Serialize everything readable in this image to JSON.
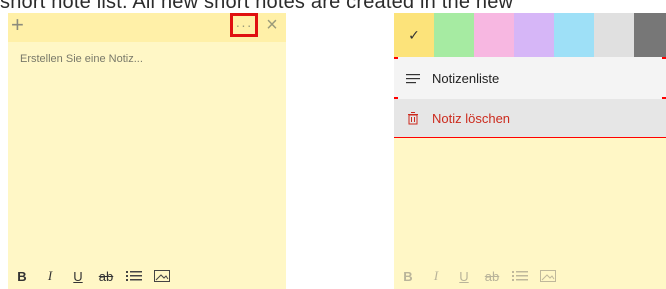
{
  "caption": "short note list. All new short notes are created in the new",
  "left_note": {
    "add_glyph": "+",
    "more_glyph": "···",
    "close_glyph": "×",
    "placeholder": "Erstellen Sie eine Notiz...",
    "toolbar": {
      "bold": "B",
      "italic": "I",
      "underline": "U",
      "strike": "ab",
      "list_icon": "list-icon",
      "image_icon": "image-icon"
    }
  },
  "right_note": {
    "toolbar": {
      "bold": "B",
      "italic": "I",
      "underline": "U",
      "strike": "ab",
      "list_icon": "list-icon",
      "image_icon": "image-icon"
    }
  },
  "menu": {
    "swatches": [
      {
        "color": "#fce37a",
        "selected": true,
        "check": "✓"
      },
      {
        "color": "#a6eba2",
        "selected": false
      },
      {
        "color": "#f7b7e1",
        "selected": false
      },
      {
        "color": "#d6b6f7",
        "selected": false
      },
      {
        "color": "#9ee0f7",
        "selected": false
      },
      {
        "color": "#e0e0e0",
        "selected": false
      },
      {
        "color": "#777777",
        "selected": false
      }
    ],
    "items": [
      {
        "label": "Notizenliste",
        "icon": "list-icon"
      },
      {
        "label": "Notiz löschen",
        "icon": "trash-icon",
        "color": "#cc2b1e"
      }
    ]
  },
  "colors": {
    "highlight_outline": "#ff0000",
    "note_bg": "#fff7c6",
    "note_header": "#fff0a8"
  }
}
